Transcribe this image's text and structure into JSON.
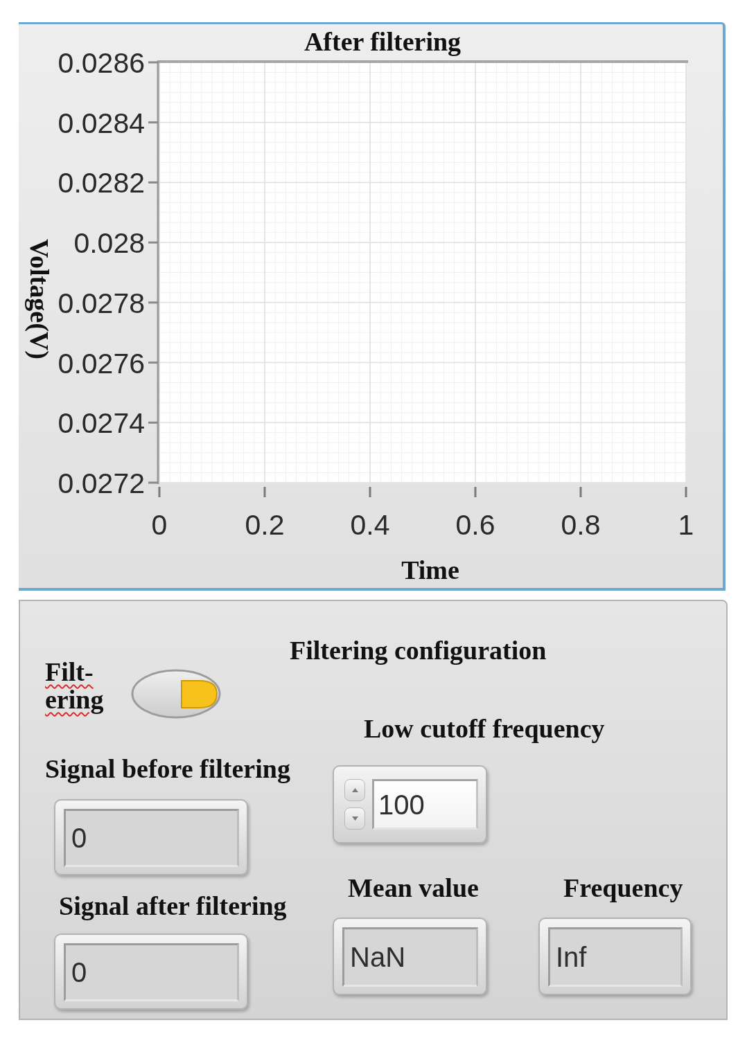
{
  "chart_panel": {
    "chart_data": {
      "type": "line",
      "title": "After filtering",
      "xlabel": "Time",
      "ylabel": "Voltage(V)",
      "xlim": [
        0,
        1
      ],
      "ylim": [
        0.0272,
        0.0286
      ],
      "xticks": [
        0,
        0.2,
        0.4,
        0.6,
        0.8,
        1
      ],
      "yticks": [
        0.0272,
        0.0274,
        0.0276,
        0.0278,
        0.028,
        0.0282,
        0.0284,
        0.0286
      ],
      "grid": true
    }
  },
  "controls_panel": {
    "filtering": {
      "label": "Filt-ering",
      "misspelled": true,
      "on": true
    },
    "title": "Filtering configuration",
    "signal_before": {
      "label": "Signal before filtering",
      "value": "0"
    },
    "signal_after": {
      "label": "Signal after filtering",
      "value": "0"
    },
    "low_cutoff": {
      "label": "Low cutoff frequency",
      "value": "100"
    },
    "mean_value": {
      "label": "Mean value",
      "value": "NaN"
    },
    "frequency": {
      "label": "Frequency",
      "value": "Inf"
    }
  }
}
